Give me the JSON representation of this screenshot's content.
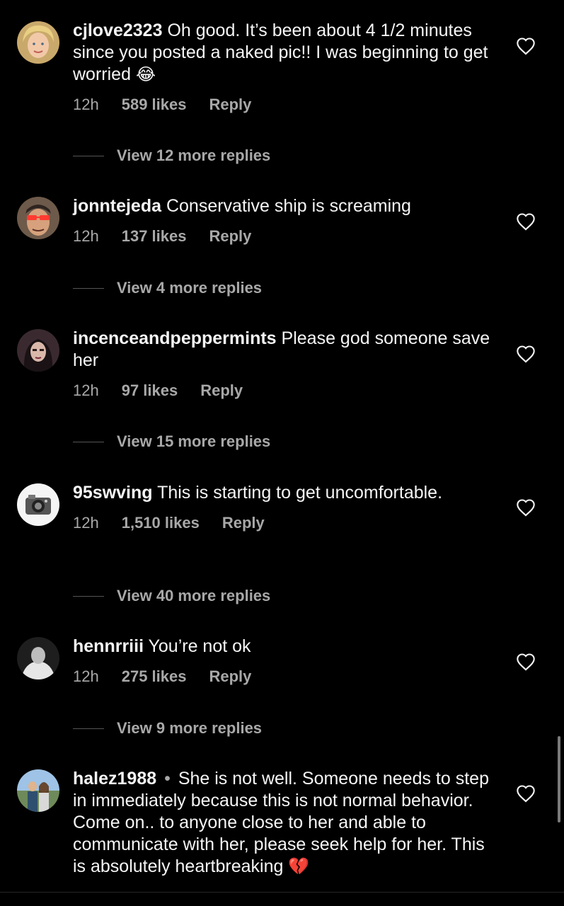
{
  "comments": [
    {
      "username": "cjlove2323",
      "separator": "",
      "text": "Oh good. It’s been about 4 1/2 minutes since you posted a naked pic!! I was beginning to get worried",
      "emoji": "😂",
      "time": "12h",
      "likes": "589 likes",
      "reply": "Reply",
      "view_replies": "View 12 more replies",
      "avatar": "blonde-woman-avatar"
    },
    {
      "username": "jonntejeda",
      "separator": "",
      "text": "Conservative ship is screaming",
      "emoji": "",
      "time": "12h",
      "likes": "137 likes",
      "reply": "Reply",
      "view_replies": "View 4 more replies",
      "avatar": "man-with-red-sunglasses-avatar"
    },
    {
      "username": "incenceandpeppermints",
      "separator": "",
      "text": "Please god someone save her",
      "emoji": "",
      "time": "12h",
      "likes": "97 likes",
      "reply": "Reply",
      "view_replies": "View 15 more replies",
      "avatar": "dark-haired-woman-avatar"
    },
    {
      "username": "95swving",
      "separator": "",
      "text": "This is starting to get uncomfortable.",
      "emoji": "",
      "time": "12h",
      "likes": "1,510 likes",
      "reply": "Reply",
      "view_replies": "View 40 more replies",
      "avatar": "camera-avatar"
    },
    {
      "username": "hennrriii",
      "separator": "",
      "text": "You’re not ok",
      "emoji": "",
      "time": "12h",
      "likes": "275 likes",
      "reply": "Reply",
      "view_replies": "View 9 more replies",
      "avatar": "black-and-white-person-avatar"
    },
    {
      "username": "halez1988",
      "separator": "•",
      "text": "She is not well. Someone needs to step in immediately because this is not normal behavior. Come on.. to anyone close to her and able to communicate with her, please seek help for her. This is absolutely heartbreaking",
      "emoji": "💔",
      "time": "",
      "likes": "",
      "reply": "",
      "view_replies": "",
      "avatar": "couple-outdoors-avatar"
    }
  ],
  "icons": {
    "like": "heart-outline-icon"
  },
  "colors": {
    "background": "#000000",
    "text": "#f5f5f5",
    "muted": "#a8a8a8",
    "heartbreak": "#e0245e"
  }
}
